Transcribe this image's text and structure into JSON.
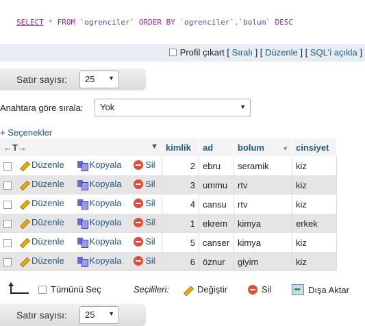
{
  "sql": {
    "select": "SELECT",
    "star": "*",
    "from": "FROM",
    "table": "`ogrenciler`",
    "order_by": "ORDER BY",
    "col": "`ogrenciler`.`bolum`",
    "desc": "DESC"
  },
  "sql_actions": {
    "profil": "Profil çıkart",
    "sirali": "Sıralı",
    "duzenle": "Düzenle",
    "sql": "SQL'i açıkla"
  },
  "nav_top": {
    "rows_label": "Satır sayısı:",
    "rows_value": "25"
  },
  "sort": {
    "label": "Anahtara göre sırala:",
    "value": "Yok"
  },
  "options_label": "+ Seçenekler",
  "table": {
    "nav_arrows": "←T→",
    "headers": [
      "kimlik",
      "ad",
      "bolum",
      "cinsiyet"
    ],
    "actions": {
      "edit": "Düzenle",
      "copy": "Kopyala",
      "delete": "Sil"
    },
    "rows": [
      {
        "kimlik": "2",
        "ad": "ebru",
        "bolum": "seramik",
        "cinsiyet": "kiz"
      },
      {
        "kimlik": "3",
        "ad": "ummu",
        "bolum": "rtv",
        "cinsiyet": "kiz"
      },
      {
        "kimlik": "4",
        "ad": "cansu",
        "bolum": "rtv",
        "cinsiyet": "kiz"
      },
      {
        "kimlik": "1",
        "ad": "ekrem",
        "bolum": "kimya",
        "cinsiyet": "erkek"
      },
      {
        "kimlik": "5",
        "ad": "canser",
        "bolum": "kimya",
        "cinsiyet": "kiz"
      },
      {
        "kimlik": "6",
        "ad": "öznur",
        "bolum": "giyim",
        "cinsiyet": "kiz"
      }
    ]
  },
  "footer": {
    "check_all": "Tümünü Seç",
    "with_selected": "Seçilileri:",
    "change": "Değiştir",
    "delete": "Sil",
    "export": "Dışa Aktar"
  },
  "nav_bottom": {
    "rows_label": "Satır sayısı:",
    "rows_value": "25"
  }
}
